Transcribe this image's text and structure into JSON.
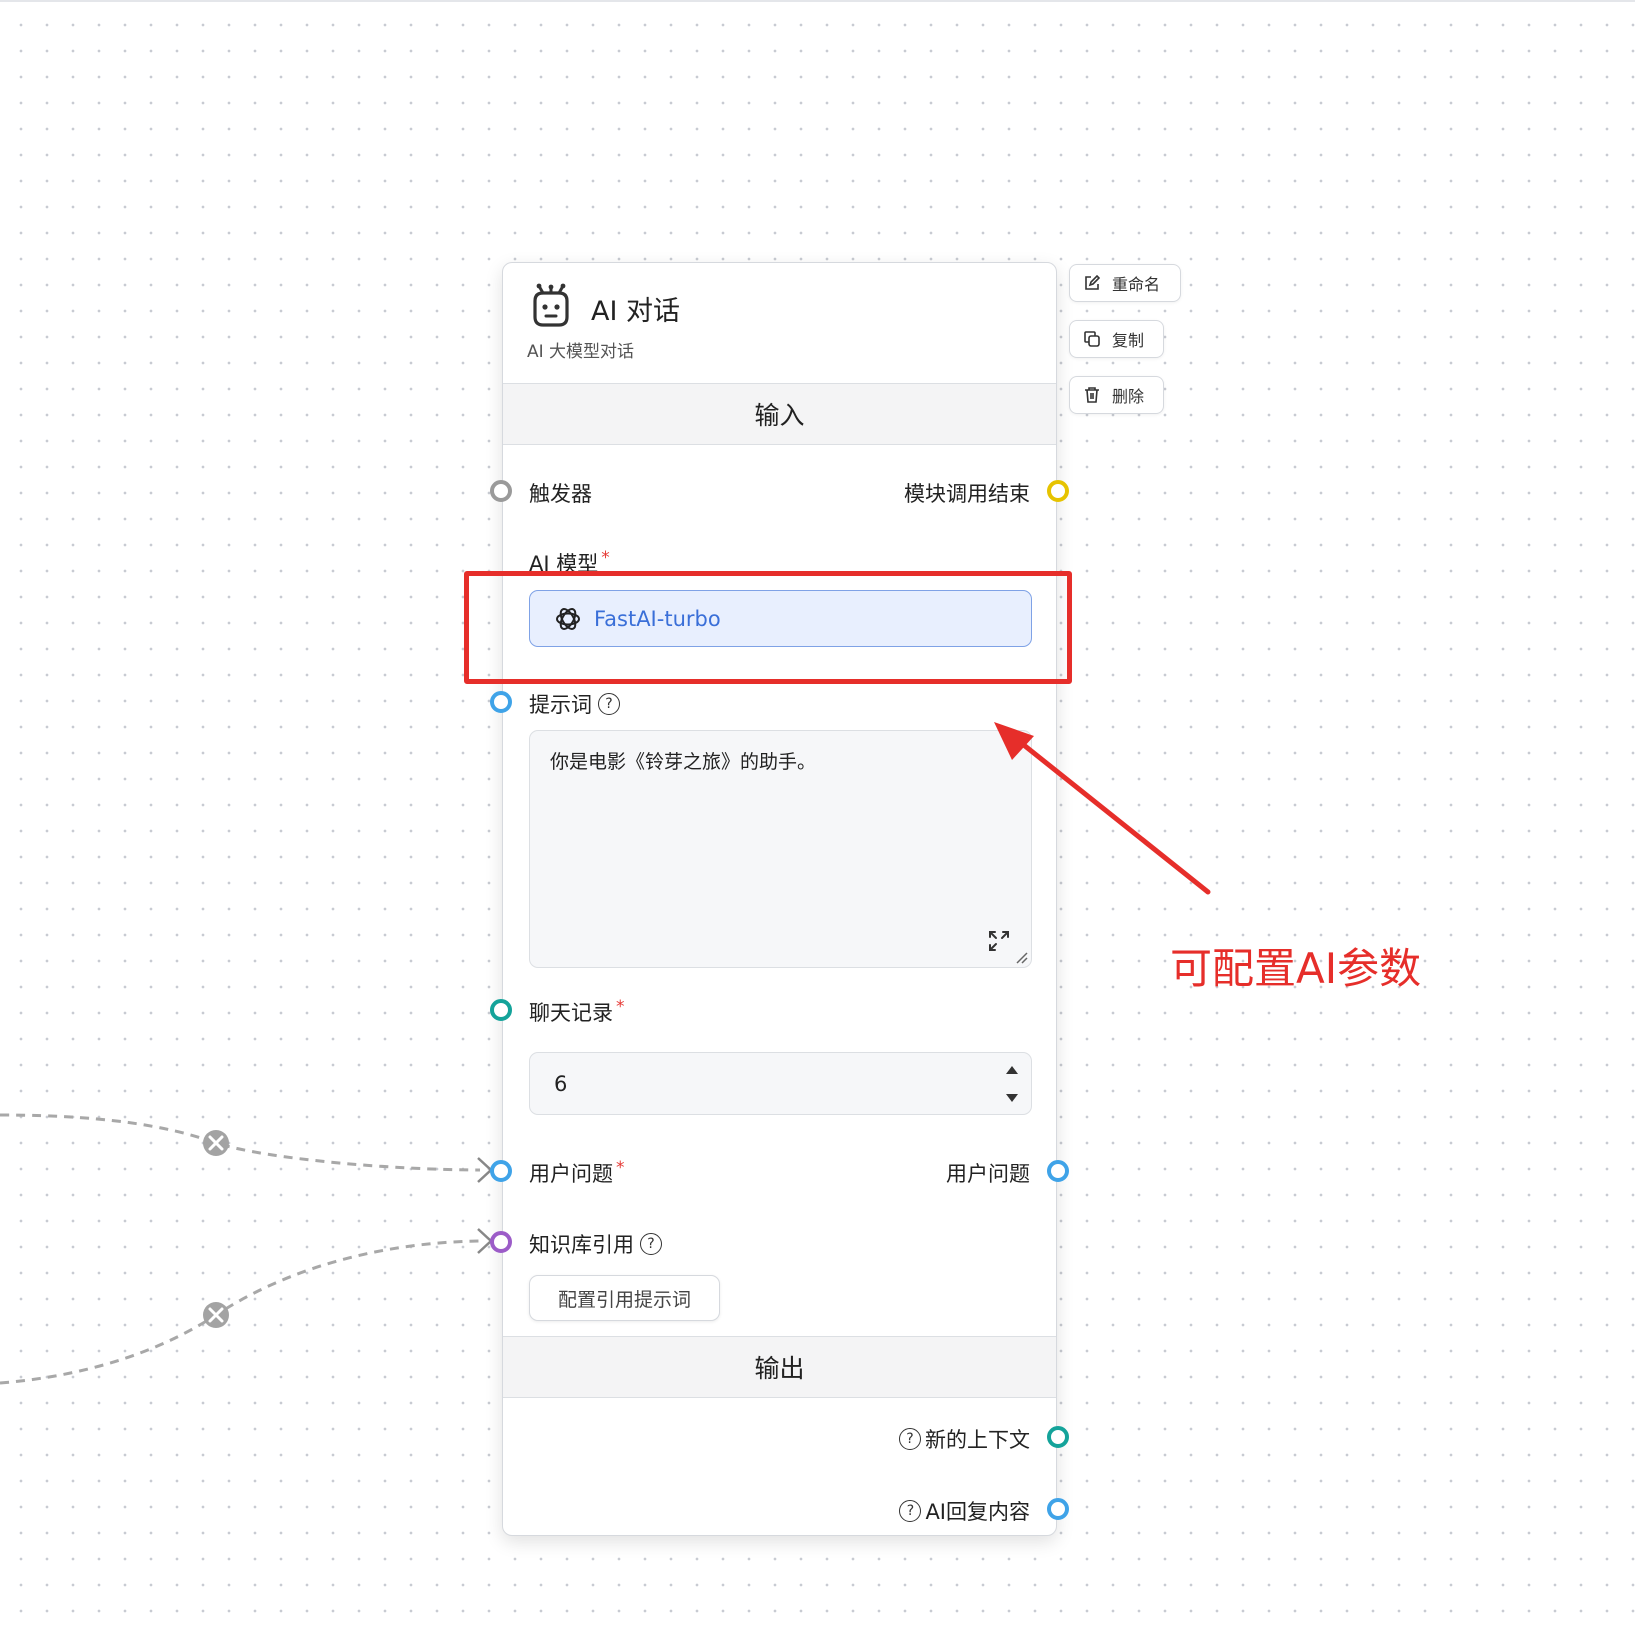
{
  "node": {
    "title": "AI 对话",
    "subtitle": "AI 大模型对话",
    "icon": "robot-icon",
    "sections": {
      "input": "输入",
      "output": "输出"
    }
  },
  "actions": {
    "rename": "重命名",
    "copy": "复制",
    "delete": "删除"
  },
  "inputs": {
    "trigger": "触发器",
    "module_end": "模块调用结束",
    "ai_model_label": "AI 模型",
    "ai_model_value": "FastAI-turbo",
    "prompt_label": "提示词",
    "prompt_value": "你是电影《铃芽之旅》的助手。",
    "history_label": "聊天记录",
    "history_value": "6",
    "user_question_label": "用户问题",
    "user_question_output": "用户问题",
    "kb_label": "知识库引用",
    "kb_button": "配置引用提示词",
    "required_mark": "*",
    "help_mark": "?"
  },
  "outputs": {
    "new_context": "新的上下文",
    "ai_reply": "AI回复内容"
  },
  "annotation": {
    "text": "可配置AI参数",
    "color": "#e62e2a"
  },
  "colors": {
    "handle_gray": "#9a9a9a",
    "handle_yellow": "#e6c300",
    "handle_blue": "#3fa3e8",
    "handle_teal": "#14a39a",
    "handle_purple": "#9c5cc8",
    "model_accent": "#3a6fd8"
  }
}
